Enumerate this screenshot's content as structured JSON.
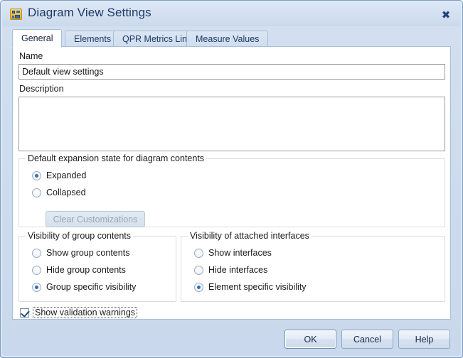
{
  "window": {
    "title": "Diagram View Settings",
    "icon": "diagram-view-icon",
    "close_label": "✖"
  },
  "tabs": [
    {
      "label": "General",
      "active": true
    },
    {
      "label": "Elements",
      "active": false
    },
    {
      "label": "QPR Metrics Link",
      "active": false
    },
    {
      "label": "Measure Values",
      "active": false
    }
  ],
  "general": {
    "name_label": "Name",
    "name_value": "Default view settings",
    "name_placeholder": "",
    "description_label": "Description",
    "description_value": "",
    "description_placeholder": "",
    "expansion": {
      "legend": "Default expansion state for diagram contents",
      "options": [
        {
          "label": "Expanded",
          "selected": true
        },
        {
          "label": "Collapsed",
          "selected": false
        }
      ],
      "clear_button_label": "Clear Customizations",
      "clear_button_enabled": false
    },
    "group_visibility": {
      "legend": "Visibility of group contents",
      "options": [
        {
          "label": "Show group contents",
          "selected": false
        },
        {
          "label": "Hide group contents",
          "selected": false
        },
        {
          "label": "Group specific visibility",
          "selected": true
        }
      ]
    },
    "interface_visibility": {
      "legend": "Visibility of attached interfaces",
      "options": [
        {
          "label": "Show interfaces",
          "selected": false
        },
        {
          "label": "Hide interfaces",
          "selected": false
        },
        {
          "label": "Element specific visibility",
          "selected": true
        }
      ]
    },
    "validation": {
      "label": "Show validation warnings",
      "checked": true,
      "focused": true
    }
  },
  "footer": {
    "ok_label": "OK",
    "cancel_label": "Cancel",
    "help_label": "Help",
    "default_button": "OK"
  },
  "colors": {
    "window_chrome": "#cedcee",
    "title_text": "#1f3a66",
    "panel_background": "#ffffff",
    "accent_radio": "#2f6fb5",
    "icon_orange": "#f2b93e",
    "icon_blue": "#2e6fb0"
  }
}
